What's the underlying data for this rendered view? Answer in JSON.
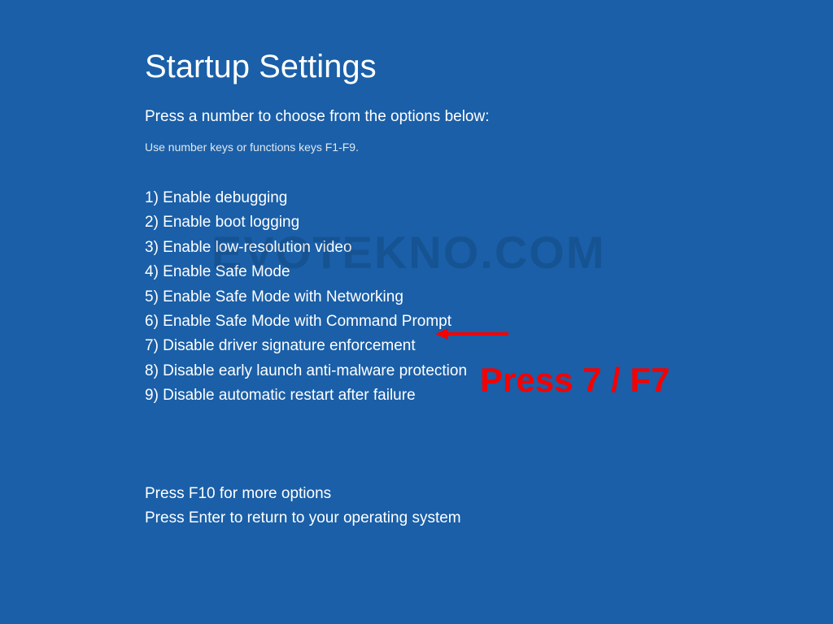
{
  "title": "Startup Settings",
  "subtitle": "Press a number to choose from the options below:",
  "hint": "Use number keys or functions keys F1-F9.",
  "options": [
    "1) Enable debugging",
    "2) Enable boot logging",
    "3) Enable low-resolution video",
    "4) Enable Safe Mode",
    "5) Enable Safe Mode with Networking",
    "6) Enable Safe Mode with Command Prompt",
    "7) Disable driver signature enforcement",
    "8) Disable early launch anti-malware protection",
    "9) Disable automatic restart after failure"
  ],
  "footer": {
    "line1": "Press F10 for more options",
    "line2": "Press Enter to return to your operating system"
  },
  "watermark": "EVOTEKNO.COM",
  "annotation_text": "Press 7 / F7"
}
